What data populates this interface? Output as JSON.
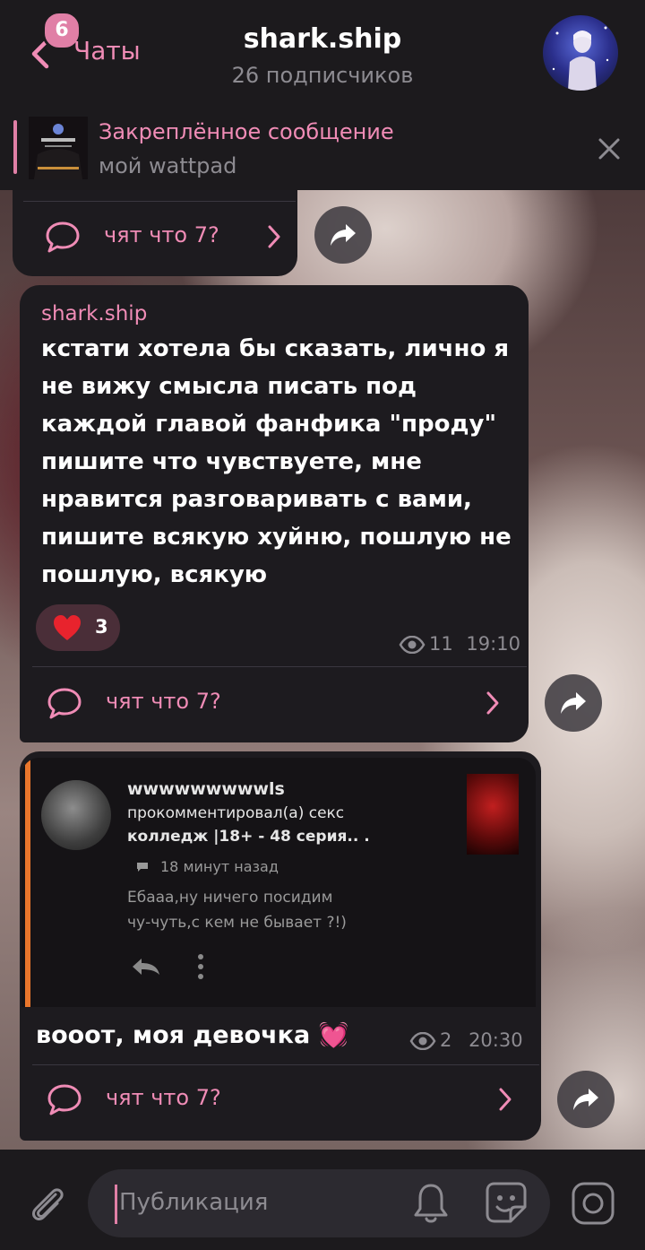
{
  "header": {
    "back_label": "Чаты",
    "unread_badge": "6",
    "title": "shark.ship",
    "subtitle": "26 подписчиков"
  },
  "pinned": {
    "title": "Закреплённое сообщение",
    "text": "мой wattpad"
  },
  "posts": [
    {
      "comment_label": "чят что 7?"
    },
    {
      "author": "shark.ship",
      "text": "кстати хотела бы сказать, лично я не вижу смысла писать под каждой главой фанфика \"проду\" пишите что чувствуете, мне нравится разговаривать с вами, пишите всякую хуйню, пошлую не пошлую, всякую",
      "reaction_count": "3",
      "views": "11",
      "time": "19:10",
      "comment_label": "чят что 7?"
    },
    {
      "screenshot": {
        "user": "wwwwwwwwwls",
        "line1": "прокомментировал(а) секс",
        "line2": "колледж |18+ - 48 серия.. .",
        "time_ago": "18 минут назад",
        "comment_line1": "Ебааа,ну ничего посидим",
        "comment_line2": "чу-чуть,с кем не бывает ?!)"
      },
      "text": "вооот, моя девочка 💓",
      "views": "2",
      "time": "20:30",
      "comment_label": "чят что 7?"
    }
  ],
  "input": {
    "placeholder": "Публикация"
  },
  "colors": {
    "accent": "#e07fa6",
    "bubble": "#1d1b1f",
    "header": "#1c1a1d"
  }
}
